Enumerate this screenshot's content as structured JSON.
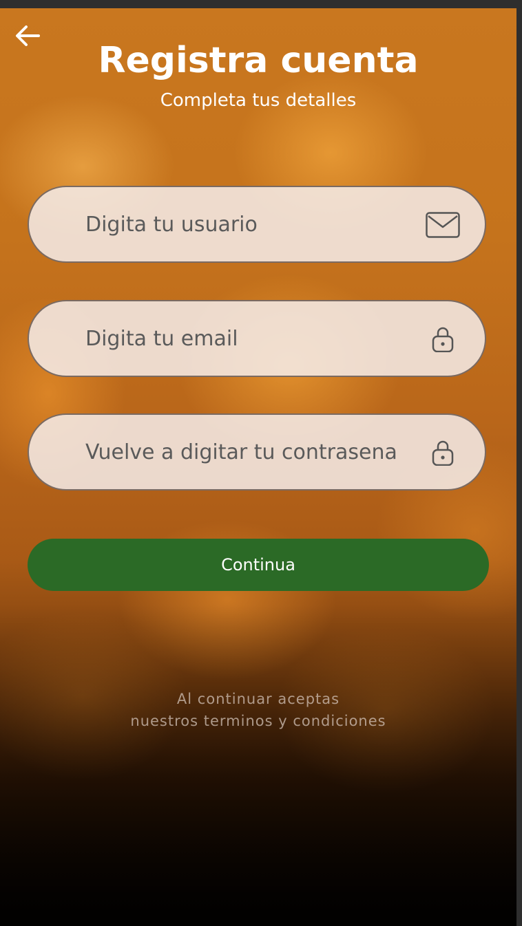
{
  "header": {
    "back_icon": "arrow-left-icon",
    "title": "Registra cuenta",
    "subtitle": "Completa tus detalles"
  },
  "form": {
    "username": {
      "placeholder": "Digita tu usuario",
      "value": "",
      "icon": "envelope-icon"
    },
    "email": {
      "placeholder": "Digita tu email",
      "value": "",
      "icon": "lock-icon"
    },
    "password_confirm": {
      "placeholder": "Vuelve a digitar tu contrasena",
      "value": "",
      "icon": "lock-icon"
    },
    "continue_label": "Continua"
  },
  "footer": {
    "terms_line1": "Al continuar aceptas",
    "terms_line2": "nuestros terminos y condiciones"
  },
  "colors": {
    "primary_button": "#2b6a26",
    "field_background": "#f4ecea",
    "field_border": "#7a6a62",
    "background_orange": "#c9771f"
  }
}
